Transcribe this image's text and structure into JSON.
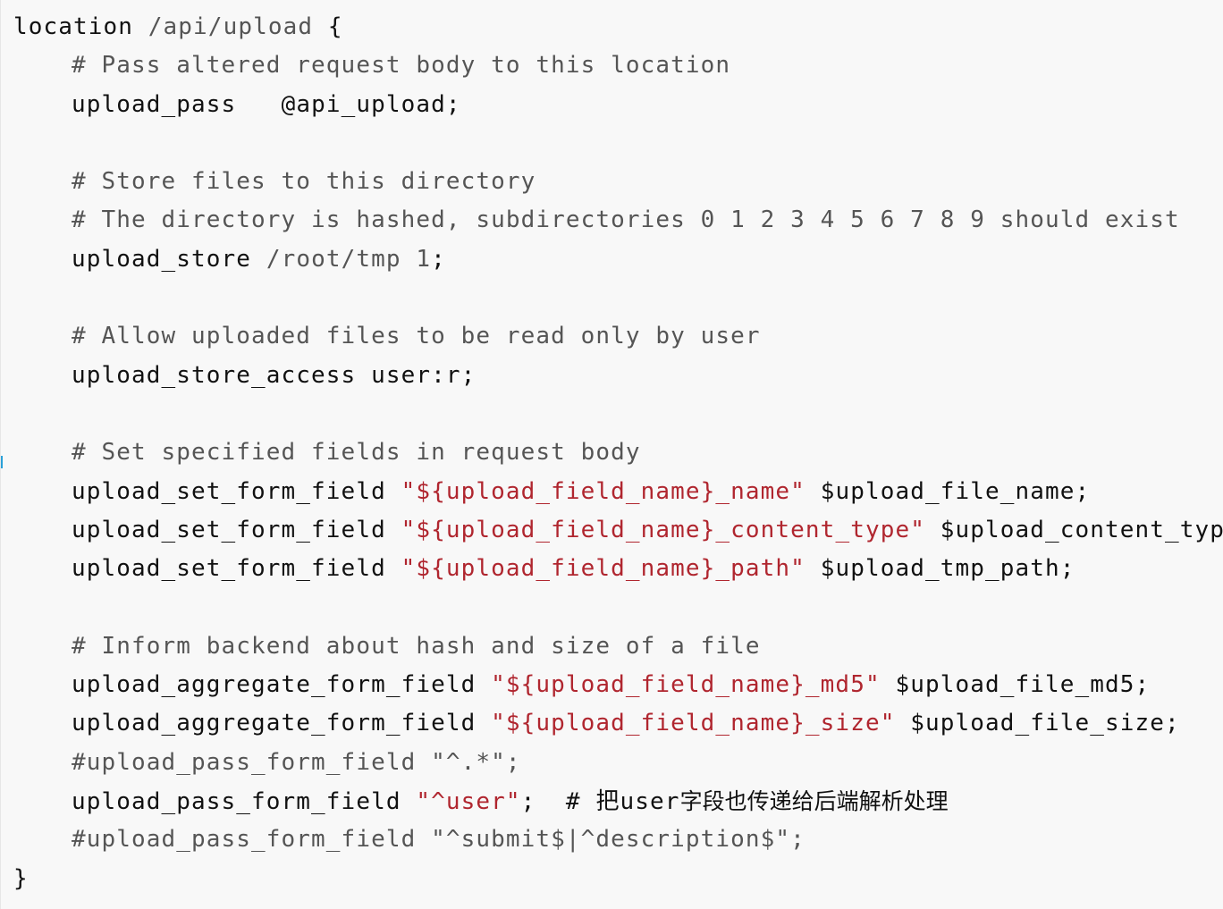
{
  "code": {
    "l01": {
      "kw": "location",
      "path": "/api/upload",
      "brace": "{"
    },
    "l02": {
      "comment": "# Pass altered request body to this location"
    },
    "l03": {
      "directive": "upload_pass",
      "value": "@api_upload;"
    },
    "l05": {
      "comment": "# Store files to this directory"
    },
    "l06": {
      "comment": "# The directory is hashed, subdirectories 0 1 2 3 4 5 6 7 8 9 should exist"
    },
    "l07": {
      "directive": "upload_store",
      "path": "/root/tmp",
      "num": "1",
      "semi": ";"
    },
    "l09": {
      "comment": "# Allow uploaded files to be read only by user"
    },
    "l10": {
      "directive": "upload_store_access",
      "value": "user:r;"
    },
    "l12": {
      "comment": "# Set specified fields in request body"
    },
    "l13": {
      "directive": "upload_set_form_field",
      "string": "\"${upload_field_name}_name\"",
      "variable": "$upload_file_name;"
    },
    "l14": {
      "directive": "upload_set_form_field",
      "string": "\"${upload_field_name}_content_type\"",
      "variable": "$upload_content_type;"
    },
    "l15": {
      "directive": "upload_set_form_field",
      "string": "\"${upload_field_name}_path\"",
      "variable": "$upload_tmp_path;"
    },
    "l17": {
      "comment": "# Inform backend about hash and size of a file"
    },
    "l18": {
      "directive": "upload_aggregate_form_field",
      "string": "\"${upload_field_name}_md5\"",
      "variable": "$upload_file_md5;"
    },
    "l19": {
      "directive": "upload_aggregate_form_field",
      "string": "\"${upload_field_name}_size\"",
      "variable": "$upload_file_size;"
    },
    "l20": {
      "comment": "#upload_pass_form_field \"^.*\";"
    },
    "l21": {
      "directive": "upload_pass_form_field",
      "string": "\"^user\"",
      "semi": ";",
      "comment_hash": "#",
      "comment_user": "把user",
      "comment_cjk": "字段也传递给后端解析处理"
    },
    "l22": {
      "comment": "#upload_pass_form_field \"^submit$|^description$\";"
    },
    "l23": {
      "brace": "}"
    }
  }
}
